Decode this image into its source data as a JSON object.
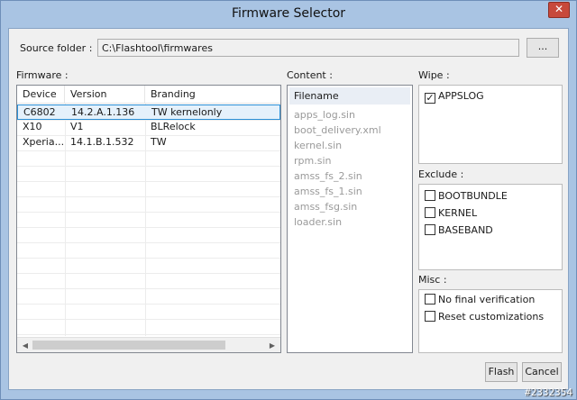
{
  "window": {
    "title": "Firmware Selector",
    "close_glyph": "✕",
    "close_icon": "close-icon"
  },
  "source": {
    "label": "Source folder :",
    "value": "C:\\Flashtool\\firmwares",
    "browse_label": "..."
  },
  "firmware": {
    "label": "Firmware :",
    "columns": [
      "Device",
      "Version",
      "Branding"
    ],
    "rows": [
      {
        "device": "C6802",
        "version": "14.2.A.1.136",
        "branding": "TW kernelonly"
      },
      {
        "device": "X10",
        "version": "V1",
        "branding": "BLRelock"
      },
      {
        "device": "Xperia...",
        "version": "14.1.B.1.532",
        "branding": "TW"
      }
    ],
    "selected_index": 0
  },
  "content": {
    "label": "Content :",
    "header": "Filename",
    "files": [
      "apps_log.sin",
      "boot_delivery.xml",
      "kernel.sin",
      "rpm.sin",
      "amss_fs_2.sin",
      "amss_fs_1.sin",
      "amss_fsg.sin",
      "loader.sin"
    ]
  },
  "wipe": {
    "label": "Wipe :",
    "items": [
      {
        "label": "APPSLOG",
        "checked": true
      }
    ]
  },
  "exclude": {
    "label": "Exclude :",
    "items": [
      {
        "label": "BOOTBUNDLE",
        "checked": false
      },
      {
        "label": "KERNEL",
        "checked": false
      },
      {
        "label": "BASEBAND",
        "checked": false
      }
    ]
  },
  "misc": {
    "label": "Misc :",
    "items": [
      {
        "label": "No final verification",
        "checked": false
      },
      {
        "label": "Reset customizations",
        "checked": false
      }
    ]
  },
  "buttons": {
    "flash": "Flash",
    "cancel": "Cancel"
  },
  "watermark": "#2332354",
  "colors": {
    "selection_border": "#2b8fd6",
    "selection_fill": "#e5f1fb",
    "frame": "#a9c4e3"
  }
}
